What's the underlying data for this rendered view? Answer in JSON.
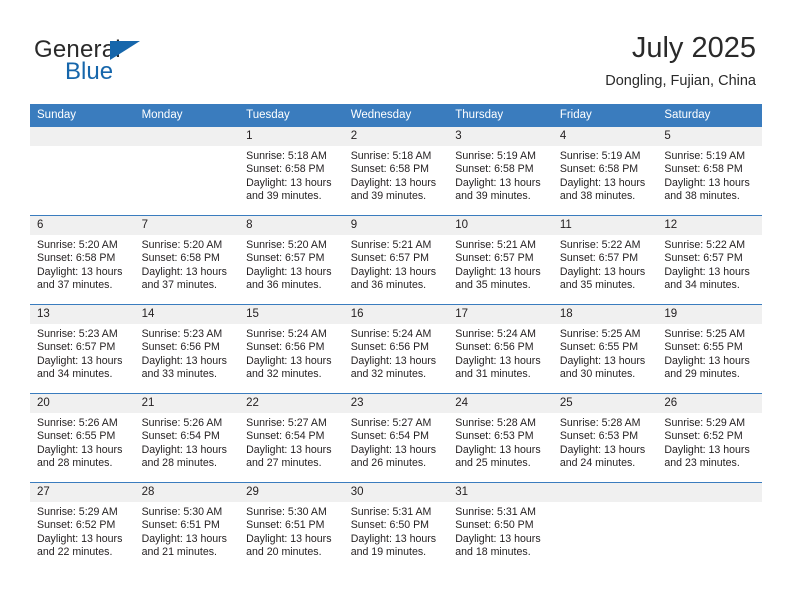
{
  "brand": {
    "name_part1": "General",
    "name_part2": "Blue",
    "logo_icon": "triangle-logo-icon"
  },
  "header": {
    "title": "July 2025",
    "location": "Dongling, Fujian, China"
  },
  "calendar": {
    "weekday_headers": [
      "Sunday",
      "Monday",
      "Tuesday",
      "Wednesday",
      "Thursday",
      "Friday",
      "Saturday"
    ],
    "accent_color": "#3a7cbe",
    "daynum_band_color": "#f0f0f0",
    "weeks": [
      [
        {
          "day": "",
          "lines": []
        },
        {
          "day": "",
          "lines": []
        },
        {
          "day": "1",
          "lines": [
            "Sunrise: 5:18 AM",
            "Sunset: 6:58 PM",
            "Daylight: 13 hours and 39 minutes."
          ]
        },
        {
          "day": "2",
          "lines": [
            "Sunrise: 5:18 AM",
            "Sunset: 6:58 PM",
            "Daylight: 13 hours and 39 minutes."
          ]
        },
        {
          "day": "3",
          "lines": [
            "Sunrise: 5:19 AM",
            "Sunset: 6:58 PM",
            "Daylight: 13 hours and 39 minutes."
          ]
        },
        {
          "day": "4",
          "lines": [
            "Sunrise: 5:19 AM",
            "Sunset: 6:58 PM",
            "Daylight: 13 hours and 38 minutes."
          ]
        },
        {
          "day": "5",
          "lines": [
            "Sunrise: 5:19 AM",
            "Sunset: 6:58 PM",
            "Daylight: 13 hours and 38 minutes."
          ]
        }
      ],
      [
        {
          "day": "6",
          "lines": [
            "Sunrise: 5:20 AM",
            "Sunset: 6:58 PM",
            "Daylight: 13 hours and 37 minutes."
          ]
        },
        {
          "day": "7",
          "lines": [
            "Sunrise: 5:20 AM",
            "Sunset: 6:58 PM",
            "Daylight: 13 hours and 37 minutes."
          ]
        },
        {
          "day": "8",
          "lines": [
            "Sunrise: 5:20 AM",
            "Sunset: 6:57 PM",
            "Daylight: 13 hours and 36 minutes."
          ]
        },
        {
          "day": "9",
          "lines": [
            "Sunrise: 5:21 AM",
            "Sunset: 6:57 PM",
            "Daylight: 13 hours and 36 minutes."
          ]
        },
        {
          "day": "10",
          "lines": [
            "Sunrise: 5:21 AM",
            "Sunset: 6:57 PM",
            "Daylight: 13 hours and 35 minutes."
          ]
        },
        {
          "day": "11",
          "lines": [
            "Sunrise: 5:22 AM",
            "Sunset: 6:57 PM",
            "Daylight: 13 hours and 35 minutes."
          ]
        },
        {
          "day": "12",
          "lines": [
            "Sunrise: 5:22 AM",
            "Sunset: 6:57 PM",
            "Daylight: 13 hours and 34 minutes."
          ]
        }
      ],
      [
        {
          "day": "13",
          "lines": [
            "Sunrise: 5:23 AM",
            "Sunset: 6:57 PM",
            "Daylight: 13 hours and 34 minutes."
          ]
        },
        {
          "day": "14",
          "lines": [
            "Sunrise: 5:23 AM",
            "Sunset: 6:56 PM",
            "Daylight: 13 hours and 33 minutes."
          ]
        },
        {
          "day": "15",
          "lines": [
            "Sunrise: 5:24 AM",
            "Sunset: 6:56 PM",
            "Daylight: 13 hours and 32 minutes."
          ]
        },
        {
          "day": "16",
          "lines": [
            "Sunrise: 5:24 AM",
            "Sunset: 6:56 PM",
            "Daylight: 13 hours and 32 minutes."
          ]
        },
        {
          "day": "17",
          "lines": [
            "Sunrise: 5:24 AM",
            "Sunset: 6:56 PM",
            "Daylight: 13 hours and 31 minutes."
          ]
        },
        {
          "day": "18",
          "lines": [
            "Sunrise: 5:25 AM",
            "Sunset: 6:55 PM",
            "Daylight: 13 hours and 30 minutes."
          ]
        },
        {
          "day": "19",
          "lines": [
            "Sunrise: 5:25 AM",
            "Sunset: 6:55 PM",
            "Daylight: 13 hours and 29 minutes."
          ]
        }
      ],
      [
        {
          "day": "20",
          "lines": [
            "Sunrise: 5:26 AM",
            "Sunset: 6:55 PM",
            "Daylight: 13 hours and 28 minutes."
          ]
        },
        {
          "day": "21",
          "lines": [
            "Sunrise: 5:26 AM",
            "Sunset: 6:54 PM",
            "Daylight: 13 hours and 28 minutes."
          ]
        },
        {
          "day": "22",
          "lines": [
            "Sunrise: 5:27 AM",
            "Sunset: 6:54 PM",
            "Daylight: 13 hours and 27 minutes."
          ]
        },
        {
          "day": "23",
          "lines": [
            "Sunrise: 5:27 AM",
            "Sunset: 6:54 PM",
            "Daylight: 13 hours and 26 minutes."
          ]
        },
        {
          "day": "24",
          "lines": [
            "Sunrise: 5:28 AM",
            "Sunset: 6:53 PM",
            "Daylight: 13 hours and 25 minutes."
          ]
        },
        {
          "day": "25",
          "lines": [
            "Sunrise: 5:28 AM",
            "Sunset: 6:53 PM",
            "Daylight: 13 hours and 24 minutes."
          ]
        },
        {
          "day": "26",
          "lines": [
            "Sunrise: 5:29 AM",
            "Sunset: 6:52 PM",
            "Daylight: 13 hours and 23 minutes."
          ]
        }
      ],
      [
        {
          "day": "27",
          "lines": [
            "Sunrise: 5:29 AM",
            "Sunset: 6:52 PM",
            "Daylight: 13 hours and 22 minutes."
          ]
        },
        {
          "day": "28",
          "lines": [
            "Sunrise: 5:30 AM",
            "Sunset: 6:51 PM",
            "Daylight: 13 hours and 21 minutes."
          ]
        },
        {
          "day": "29",
          "lines": [
            "Sunrise: 5:30 AM",
            "Sunset: 6:51 PM",
            "Daylight: 13 hours and 20 minutes."
          ]
        },
        {
          "day": "30",
          "lines": [
            "Sunrise: 5:31 AM",
            "Sunset: 6:50 PM",
            "Daylight: 13 hours and 19 minutes."
          ]
        },
        {
          "day": "31",
          "lines": [
            "Sunrise: 5:31 AM",
            "Sunset: 6:50 PM",
            "Daylight: 13 hours and 18 minutes."
          ]
        },
        {
          "day": "",
          "lines": []
        },
        {
          "day": "",
          "lines": []
        }
      ]
    ]
  }
}
